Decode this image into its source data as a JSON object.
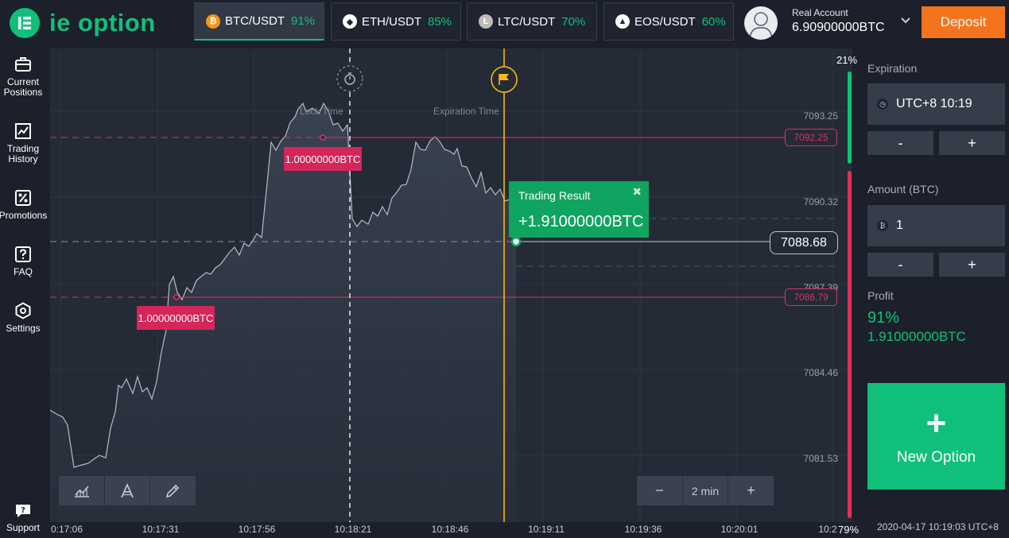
{
  "brand": {
    "name": "ie option"
  },
  "assets": [
    {
      "symbol": "BTC/USDT",
      "payout": "91%",
      "icon": "bitcoin-icon",
      "color": "#f7931a",
      "glyph": "₿"
    },
    {
      "symbol": "ETH/USDT",
      "payout": "85%",
      "icon": "ethereum-icon",
      "color": "#ffffff",
      "glyph": "◆"
    },
    {
      "symbol": "LTC/USDT",
      "payout": "70%",
      "icon": "litecoin-icon",
      "color": "#bfbbbb",
      "glyph": "Ł"
    },
    {
      "symbol": "EOS/USDT",
      "payout": "60%",
      "icon": "eos-icon",
      "color": "#ffffff",
      "glyph": "▲"
    }
  ],
  "account": {
    "label": "Real Account",
    "balance": "6.90900000BTC",
    "deposit_label": "Deposit"
  },
  "sidebar": {
    "items": [
      {
        "label1": "Current",
        "label2": "Positions",
        "icon": "briefcase-icon"
      },
      {
        "label1": "Trading",
        "label2": "History",
        "icon": "chart-history-icon"
      },
      {
        "label1": "Promotions",
        "label2": "",
        "icon": "percent-icon"
      },
      {
        "label1": "FAQ",
        "label2": "",
        "icon": "question-icon"
      },
      {
        "label1": "Settings",
        "label2": "",
        "icon": "settings-icon"
      }
    ],
    "support_label": "Support"
  },
  "chart": {
    "y_ticks": [
      "7093.25",
      "7090.32",
      "7087.39",
      "7084.46",
      "7081.53"
    ],
    "x_ticks": [
      "0:17:06",
      "10:17:31",
      "10:17:56",
      "10:18:21",
      "10:18:46",
      "10:19:11",
      "10:19:36",
      "10:20:01",
      "10:2"
    ],
    "lock_time_label": "Lock Time",
    "expiration_time_label": "Expiration Time",
    "upper_price": "7092.25",
    "lower_price": "7086.79",
    "current_price": "7088.68",
    "bet_upper": "1.00000000BTC",
    "bet_lower": "1.00000000BTC",
    "zoom_value": "2 min",
    "zoom_minus": "−",
    "zoom_plus": "+",
    "sentiment_up": "21%",
    "sentiment_down": "79%",
    "up_color": "#10c07a",
    "down_color": "#e0315c"
  },
  "trading_result": {
    "title": "Trading Result",
    "value": "+1.91000000BTC",
    "close": "✖"
  },
  "panel": {
    "expiration_label": "Expiration",
    "expiration_value": "UTC+8 10:19",
    "amount_label": "Amount (BTC)",
    "amount_value": "1",
    "minus": "-",
    "plus": "+",
    "profit_label": "Profit",
    "profit_pct": "91%",
    "profit_amount": "1.91000000BTC",
    "new_option_plus": "+",
    "new_option_label": "New Option",
    "timestamp": "2020-04-17 10:19:03 UTC+8"
  }
}
